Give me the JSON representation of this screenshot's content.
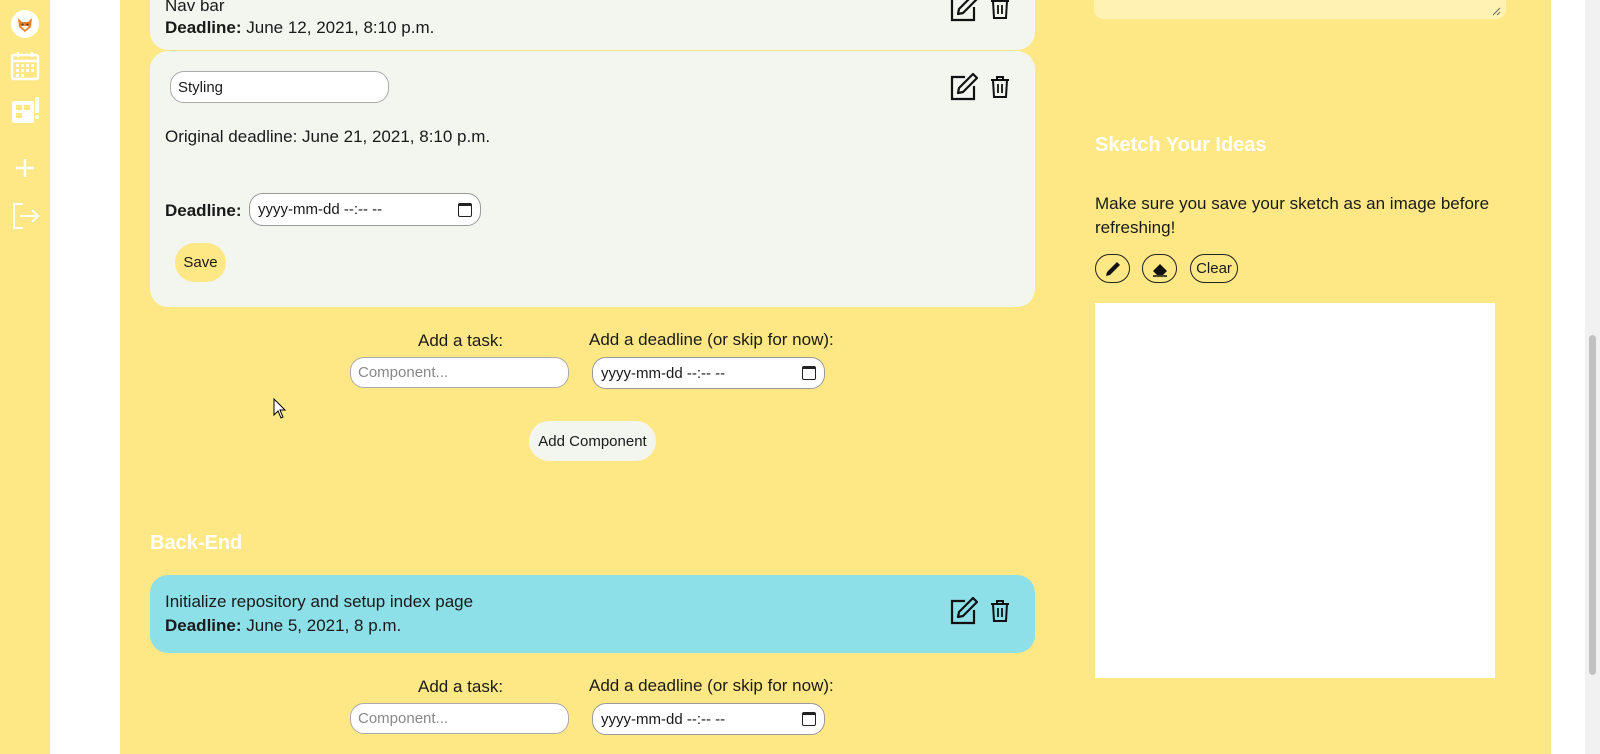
{
  "sidebar": {
    "items": [
      {
        "name": "avatar",
        "icon": "fox-avatar-icon"
      },
      {
        "name": "calendar",
        "icon": "calendar-icon"
      },
      {
        "name": "board",
        "icon": "board-icon"
      },
      {
        "name": "add",
        "icon": "plus-icon"
      },
      {
        "name": "logout",
        "icon": "logout-icon"
      }
    ],
    "color": "#fee885"
  },
  "frontend": {
    "navbar_card": {
      "title": "Nav bar",
      "deadline_label": "Deadline:",
      "deadline_value": "June 12, 2021, 8:10 p.m."
    },
    "styling_card": {
      "name_value": "Styling",
      "original_deadline": "Original deadline: June 21, 2021, 8:10 p.m.",
      "deadline_label": "Deadline:",
      "deadline_placeholder": "yyyy-mm-dd --:-- --",
      "save_label": "Save"
    },
    "add_task_label": "Add a task:",
    "add_deadline_label": "Add a deadline (or skip for now):",
    "component_placeholder": "Component...",
    "date_placeholder": "yyyy-mm-dd --:-- --",
    "add_component_label": "Add Component"
  },
  "backend": {
    "title": "Back-End",
    "task_card": {
      "title": "Initialize repository and setup index page",
      "deadline_label": "Deadline:",
      "deadline_value": "June 5, 2021, 8 p.m."
    },
    "add_task_label": "Add a task:",
    "add_deadline_label": "Add a deadline (or skip for now):",
    "component_placeholder": "Component...",
    "date_placeholder": "yyyy-mm-dd --:-- --"
  },
  "sketch": {
    "title": "Sketch Your Ideas",
    "note": "Make sure you save your sketch as an image before refreshing!",
    "pencil_icon": "pencil-icon",
    "eraser_icon": "eraser-icon",
    "clear_label": "Clear"
  },
  "colors": {
    "background": "#fee885",
    "card": "#f3f5ef",
    "backend_card": "#8ddfe8",
    "save_button": "#fee885"
  }
}
